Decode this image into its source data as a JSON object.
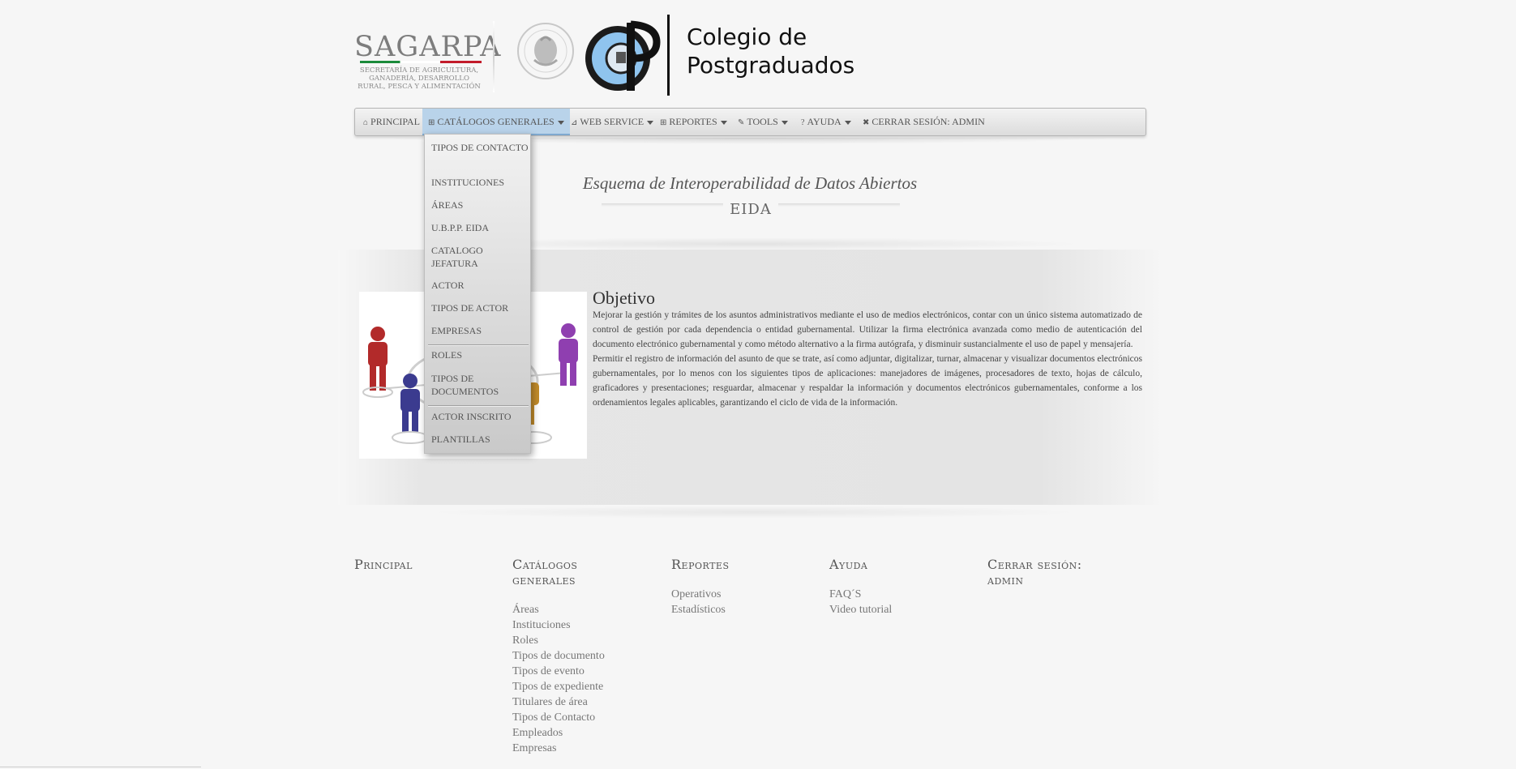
{
  "header": {
    "sagarpa_word": "SAGARPA",
    "sagarpa_sub": "Secretaría de Agricultura, Ganadería, Desarrollo Rural, Pesca y Alimentación",
    "colegio_line1": "Colegio de",
    "colegio_line2": "Postgraduados"
  },
  "nav": {
    "items": [
      {
        "label": "Principal",
        "icon": "home-icon"
      },
      {
        "label": "Catálogos Generales",
        "icon": "grid-icon"
      },
      {
        "label": "Web Service",
        "icon": "rss-icon"
      },
      {
        "label": "Reportes",
        "icon": "grid-icon"
      },
      {
        "label": "Tools",
        "icon": "wrench-icon"
      },
      {
        "label": "Ayuda",
        "icon": "question-icon"
      },
      {
        "label": "Cerrar Sesión: admin",
        "icon": "close-icon"
      }
    ]
  },
  "dropdown": {
    "items": [
      "Tipos de Contacto",
      "Instituciones",
      "Áreas",
      "U.B.P.P. EIDA",
      "Catalogo Jefatura",
      "Actor",
      "Tipos de Actor",
      "Empresas",
      "Roles",
      "Tipos de Documentos",
      "Actor Inscrito",
      "Plantillas"
    ]
  },
  "eida": {
    "title": "Esquema de Interoperabilidad de Datos Abiertos",
    "subtitle": "EIDA"
  },
  "objetivo": {
    "title": "Objetivo",
    "p1": "Mejorar la gestión y trámites de los asuntos administrativos mediante el uso de medios electrónicos, contar con un único sistema automatizado de control de gestión por cada dependencia o entidad gubernamental. Utilizar la firma electrónica avanzada como medio de autenticación del documento electrónico gubernamental y como método alternativo a la firma autógrafa, y disminuir sustancialmente el uso de papel y mensajería.",
    "p2": "Permitir el registro de información del asunto de que se trate, así como adjuntar, digitalizar, turnar, almacenar y visualizar documentos electrónicos gubernamentales, por lo menos con los siguientes tipos de aplicaciones: manejadores de imágenes, procesadores de texto, hojas de cálculo, graficadores y presentaciones; resguardar, almacenar y respaldar la información y documentos electrónicos gubernamentales, conforme a los ordenamientos legales aplicables, garantizando el ciclo de vida de la información."
  },
  "footer": {
    "principal": {
      "heading": "Principal"
    },
    "catalogos": {
      "heading": "Catálogos generales",
      "links": [
        "Áreas",
        "Instituciones",
        "Roles",
        "Tipos de documento",
        "Tipos de evento",
        "Tipos de expediente",
        "Titulares de área",
        "Tipos de Contacto",
        "Empleados",
        "Empresas"
      ]
    },
    "reportes": {
      "heading": "Reportes",
      "links": [
        "Operativos",
        "Estadísticos"
      ]
    },
    "ayuda": {
      "heading": "Ayuda",
      "links": [
        "FAQ´S",
        "Video tutorial"
      ]
    },
    "cerrar": {
      "heading": "Cerrar sesión: admin"
    }
  },
  "colors": {
    "nav_active": "#b9d3ea",
    "background": "#f6f6f6"
  }
}
